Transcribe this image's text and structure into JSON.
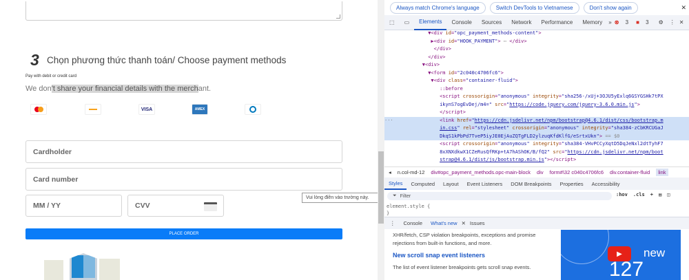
{
  "page": {
    "step_number": "3",
    "step_title": "Chọn phương thức thanh toán/ Choose payment methods",
    "pay_with": "Pay with debit or credit card",
    "share_pre": "We don",
    "share_hl": "'t share your financial details with the merch",
    "share_post": "ant.",
    "cards": [
      "Mastercard",
      "Discover",
      "VISA",
      "AMEX",
      "Diners"
    ],
    "cardholder": "Cardholder",
    "card_number": "Card number",
    "expiry": "MM / YY",
    "cvv": "CVV",
    "place_order": "PLACE ORDER",
    "tooltip": "Vui lòng điền vào trường này."
  },
  "devtools": {
    "infobar": [
      "Always match Chrome's language",
      "Switch DevTools to Vietnamese",
      "Don't show again"
    ],
    "tabs": [
      "Elements",
      "Console",
      "Sources",
      "Network",
      "Performance",
      "Memory"
    ],
    "errors": "3",
    "warnings": "3",
    "breadcrumbs": [
      "n.col-md-12",
      "div#opc_payment_methods.opc-main-block",
      "div",
      "form#\\32 c040c4706fc6",
      "div.container-fluid",
      "link"
    ],
    "style_tabs": [
      "Styles",
      "Computed",
      "Layout",
      "Event Listeners",
      "DOM Breakpoints",
      "Properties",
      "Accessibility"
    ],
    "filter_placeholder": "Filter",
    "hov": ":hov",
    "cls": ".cls",
    "element_style": "element.style {",
    "close_brace": "}",
    "drawer_tabs": [
      "Console",
      "What's new",
      "Issues"
    ],
    "whats_new": {
      "para1": "XHR/fetch, CSP violation breakpoints, exceptions and promise rejections from built-in functions, and more.",
      "heading": "New scroll snap event listeners",
      "para2": "The list of event listener breakpoints gets scroll snap events.",
      "video_new": "new",
      "video_num": "127"
    }
  }
}
